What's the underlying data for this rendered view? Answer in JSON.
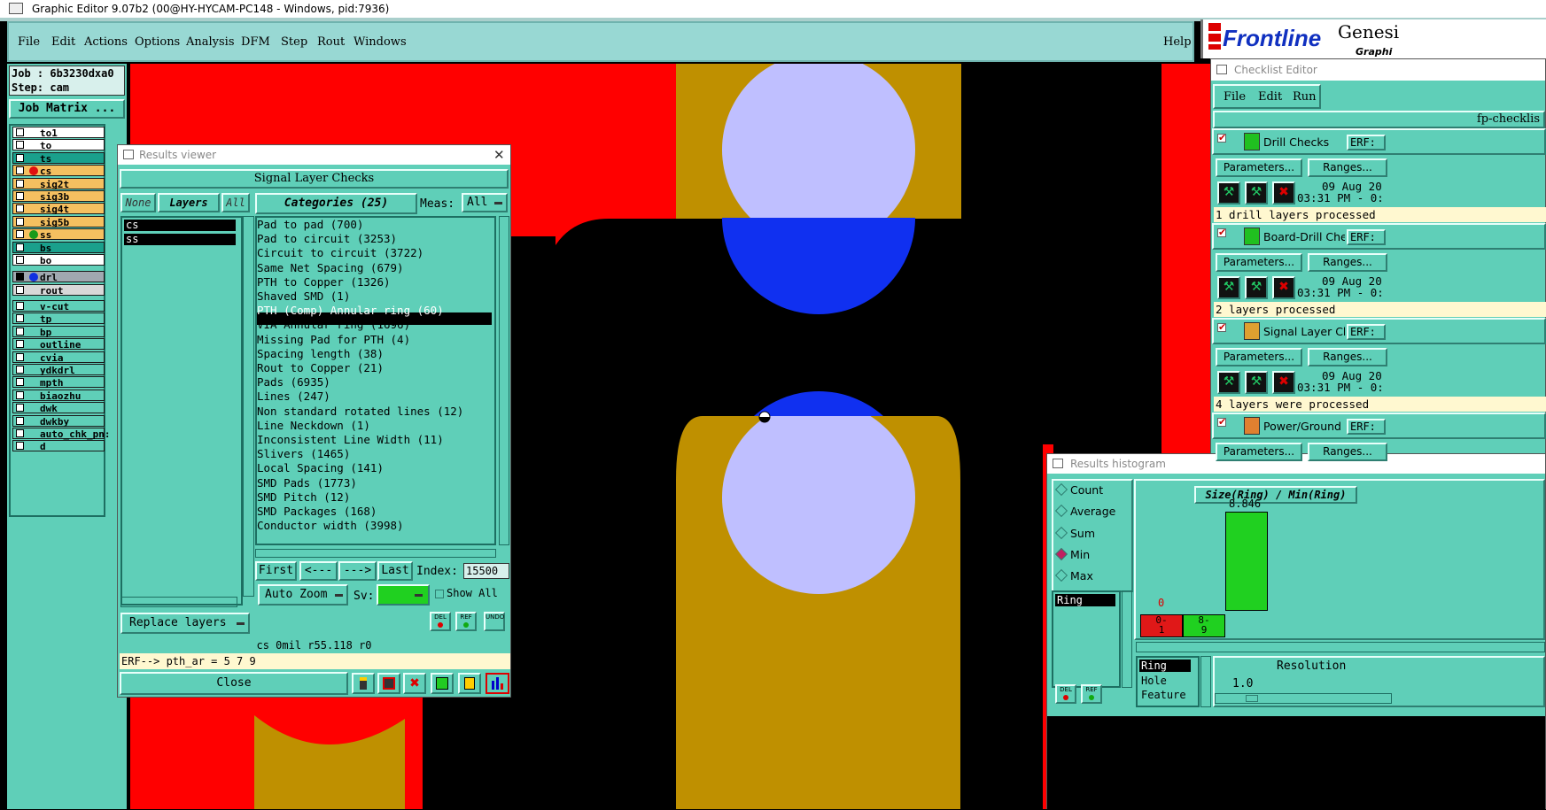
{
  "window": {
    "title": "Graphic Editor 9.07b2 (00@HY-HYCAM-PC148 - Windows, pid:7936)"
  },
  "menu": {
    "items": [
      "File",
      "Edit",
      "Actions",
      "Options",
      "Analysis",
      "DFM",
      "Step",
      "Rout",
      "Windows"
    ],
    "help": "Help"
  },
  "brand": {
    "logo": "Frontline",
    "product": "Genesi",
    "sub": "Graphi"
  },
  "job": {
    "job_label": "Job : 6b3230dxa0",
    "step_label": "Step: cam",
    "matrix_button": "Job Matrix ..."
  },
  "layers": [
    {
      "name": "to1",
      "color": "#ffffff"
    },
    {
      "name": "to",
      "color": "#ffffff"
    },
    {
      "name": "ts",
      "color": "#1aa08c"
    },
    {
      "name": "cs",
      "color": "#f5c060",
      "dot": "#e01010"
    },
    {
      "name": "sig2t",
      "color": "#f5c060"
    },
    {
      "name": "sig3b",
      "color": "#f5c060"
    },
    {
      "name": "sig4t",
      "color": "#f5c060"
    },
    {
      "name": "sig5b",
      "color": "#f5c060"
    },
    {
      "name": "ss",
      "color": "#f5c060",
      "dot": "#1a9a1a"
    },
    {
      "name": "bs",
      "color": "#1aa08c"
    },
    {
      "name": "bo",
      "color": "#ffffff"
    }
  ],
  "drill_layers": [
    {
      "name": "drl",
      "color": "#a0a8b0",
      "dot": "#1030e0"
    },
    {
      "name": "rout",
      "color": "#d8d8d8"
    }
  ],
  "other_layers": [
    "v-cut",
    "tp",
    "bp",
    "outline",
    "cvia",
    "ydkdrl",
    "mpth",
    "biaozhu",
    "dwk",
    "dwkby",
    "auto_chk_pn:",
    "d"
  ],
  "results_viewer": {
    "title": "Results viewer",
    "header": "Signal Layer Checks",
    "none_btn": "None",
    "layers_btn": "Layers",
    "all_btn": "All",
    "categories_btn": "Categories (25)",
    "meas_label": "Meas:",
    "meas_value": "All",
    "layer_list": [
      "cs",
      "ss"
    ],
    "categories": [
      "Pad to pad (700)",
      "Pad to circuit (3253)",
      "Circuit to circuit (3722)",
      "Same Net Spacing (679)",
      "PTH to Copper (1326)",
      "Shaved SMD (1)",
      "PTH (Comp) Annular ring (60)",
      "VIA Annular ring (1696)",
      "Missing Pad for PTH (4)",
      "Spacing length (38)",
      "Rout to Copper (21)",
      "Pads (6935)",
      "Lines (247)",
      "Non standard rotated lines (12)",
      "Line Neckdown (1)",
      "Inconsistent Line Width (11)",
      "Slivers (1465)",
      "Local Spacing (141)",
      "SMD Pads (1773)",
      "SMD Pitch (12)",
      "SMD Packages (168)",
      "Conductor width (3998)"
    ],
    "selected_category": "PTH (Comp) Annular ring (60)",
    "nav": {
      "first": "First",
      "prev": "<---",
      "next": "--->",
      "last": "Last",
      "index_label": "Index:",
      "index_value": "15500"
    },
    "auto_zoom": "Auto Zoom",
    "sv_label": "Sv:",
    "show_all": "Show All",
    "replace_layers": "Replace layers",
    "icons": {
      "del": "DEL",
      "ref": "REF",
      "undo": "UNDO"
    },
    "status": "cs 0mil  r55.118  r0",
    "erf": "ERF--> pth_ar = 5 7 9",
    "close": "Close"
  },
  "checklist": {
    "title": "Checklist Editor",
    "menu": [
      "File",
      "Edit",
      "Run"
    ],
    "name": "fp-checklis",
    "checks": [
      {
        "name": "Drill Checks",
        "erf": "ERF:",
        "params": "Parameters...",
        "ranges": "Ranges...",
        "date": "09 Aug 20",
        "time": "03:31 PM - 0:",
        "status": "1 drill layers processed",
        "icon_color": "#20c020"
      },
      {
        "name": "Board-Drill Che",
        "erf": "ERF:",
        "params": "Parameters...",
        "ranges": "Ranges...",
        "date": "09 Aug 20",
        "time": "03:31 PM - 0:",
        "status": "2 layers processed",
        "icon_color": "#20c020"
      },
      {
        "name": "Signal Layer Ch",
        "erf": "ERF:",
        "params": "Parameters...",
        "ranges": "Ranges...",
        "date": "09 Aug 20",
        "time": "03:31 PM - 0:",
        "status": "4 layers were processed",
        "icon_color": "#e0a030"
      },
      {
        "name": "Power/Ground C",
        "erf": "ERF:",
        "params": "Parameters...",
        "ranges": "Ranges...",
        "icon_color": "#e08030"
      }
    ]
  },
  "histogram": {
    "title": "Results histogram",
    "modes": [
      "Count",
      "Average",
      "Sum",
      "Min",
      "Max"
    ],
    "selected_mode": "Min",
    "list": [
      "Ring"
    ],
    "chart_title": "Size(Ring) / Min(Ring)",
    "bins": [
      {
        "label_top": "0-",
        "label_bot": "1",
        "value": "0",
        "color": "#e01818"
      },
      {
        "label_top": "8-",
        "label_bot": "9",
        "value": "8.846",
        "color": "#20d020"
      }
    ],
    "bottom_list": [
      "Ring",
      "Hole",
      "Feature"
    ],
    "resolution_label": "Resolution",
    "resolution_value": "1.0",
    "icons": {
      "del": "DEL",
      "ref": "REF"
    }
  },
  "colors": {
    "panel": "#5fcfb8",
    "menubar": "#98d8d3",
    "copper": "#bf9000",
    "drill": "#bfbfff",
    "highlight": "#1030f0",
    "red": "#ff0000"
  }
}
